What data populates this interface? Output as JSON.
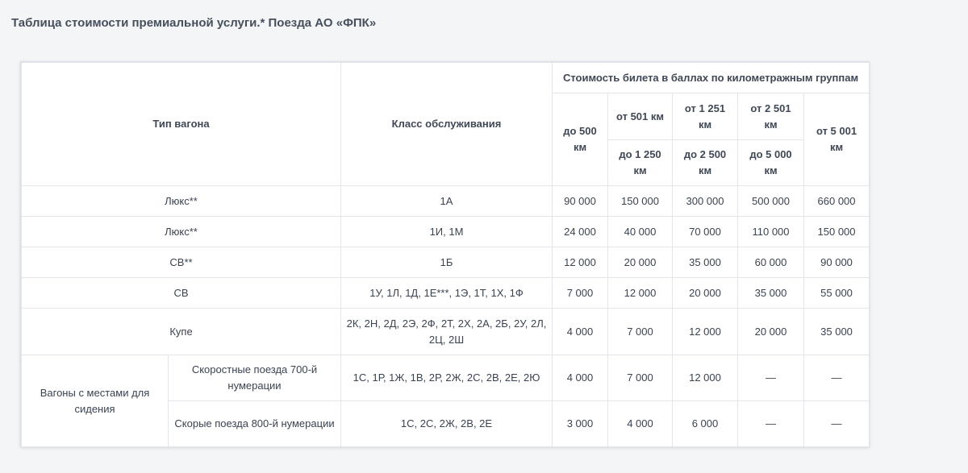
{
  "title": "Таблица стоимости премиальной услуги.* Поезда АО «ФПК»",
  "headers": {
    "wagon_type": "Тип вагона",
    "service_class": "Класс обслуживания",
    "cost_group": "Стоимость билета в баллах по километражным группам",
    "g1": "до 500 км",
    "g2_from": "от 501 км",
    "g2_to": "до 1 250 км",
    "g3_from": "от 1 251 км",
    "g3_to": "до 2 500 км",
    "g4_from": "от 2 501 км",
    "g4_to": "до 5 000 км",
    "g5": "от 5 001 км"
  },
  "rows": [
    {
      "type": "Люкс**",
      "class": "1А",
      "v": [
        "90 000",
        "150 000",
        "300 000",
        "500 000",
        "660 000"
      ]
    },
    {
      "type": "Люкс**",
      "class": "1И, 1М",
      "v": [
        "24 000",
        "40 000",
        "70 000",
        "110 000",
        "150 000"
      ]
    },
    {
      "type": "СВ**",
      "class": "1Б",
      "v": [
        "12 000",
        "20 000",
        "35 000",
        "60 000",
        "90 000"
      ]
    },
    {
      "type": "СВ",
      "class": "1У, 1Л, 1Д, 1Е***, 1Э, 1Т, 1Х, 1Ф",
      "v": [
        "7 000",
        "12 000",
        "20 000",
        "35 000",
        "55 000"
      ]
    },
    {
      "type": "Купе",
      "class": "2К, 2Н, 2Д, 2Э, 2Ф, 2Т, 2Х, 2А, 2Б, 2У, 2Л, 2Ц, 2Ш",
      "v": [
        "4 000",
        "7 000",
        "12 000",
        "20 000",
        "35 000"
      ]
    }
  ],
  "seat_group": {
    "type": "Вагоны с местами для сидения",
    "sub": [
      {
        "name": "Скоростные поезда 700-й нумерации",
        "class": "1С, 1Р, 1Ж, 1В, 2Р, 2Ж, 2С, 2В, 2Е, 2Ю",
        "v": [
          "4 000",
          "7 000",
          "12 000",
          "—",
          "—"
        ]
      },
      {
        "name": "Скорые поезда 800-й нумерации",
        "class": "1С, 2С, 2Ж, 2В, 2Е",
        "v": [
          "3 000",
          "4 000",
          "6 000",
          "—",
          "—"
        ]
      }
    ]
  }
}
